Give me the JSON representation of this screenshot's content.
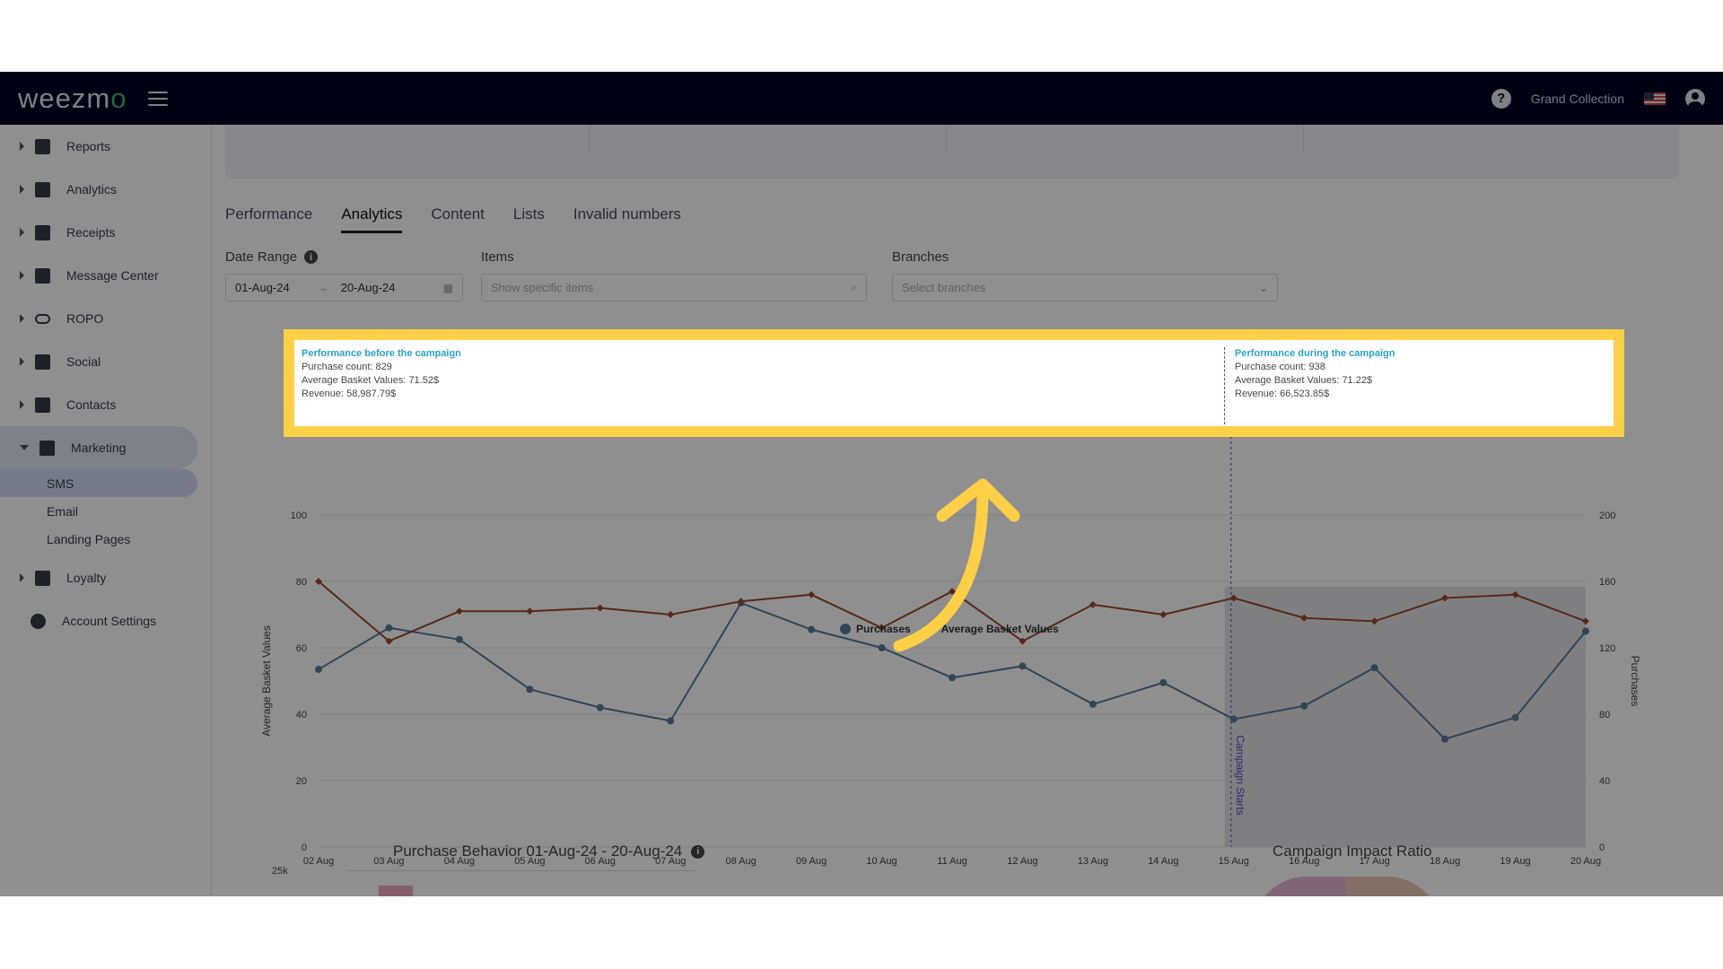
{
  "app": {
    "logo_prefix": "weezm",
    "logo_suffix": "o",
    "org_name": "Grand Collection"
  },
  "sidebar": {
    "items": [
      {
        "label": "Reports"
      },
      {
        "label": "Analytics"
      },
      {
        "label": "Receipts"
      },
      {
        "label": "Message Center"
      },
      {
        "label": "ROPO"
      },
      {
        "label": "Social"
      },
      {
        "label": "Contacts"
      },
      {
        "label": "Marketing"
      }
    ],
    "marketing_sub": [
      {
        "label": "SMS"
      },
      {
        "label": "Email"
      },
      {
        "label": "Landing Pages"
      }
    ],
    "loyalty": "Loyalty",
    "account_settings": "Account Settings"
  },
  "tabs": [
    {
      "label": "Performance"
    },
    {
      "label": "Analytics"
    },
    {
      "label": "Content"
    },
    {
      "label": "Lists"
    },
    {
      "label": "Invalid numbers"
    }
  ],
  "filters": {
    "date_range_label": "Date Range",
    "date_from": "01-Aug-24",
    "date_to": "20-Aug-24",
    "items_label": "Items",
    "items_placeholder": "Show specific items",
    "branches_label": "Branches",
    "branches_placeholder": "Select branches"
  },
  "tooltip": {
    "before_title": "Performance before the campaign",
    "before_count": "Purchase count: 829",
    "before_abv": "Average Basket Values: 71.52$",
    "before_revenue": "Revenue: 58,987.79$",
    "during_title": "Performance during the campaign",
    "during_count": "Purchase count: 938",
    "during_abv": "Average Basket Values: 71.22$",
    "during_revenue": "Revenue: 66,523.85$"
  },
  "bottom": {
    "purchase_behavior_title": "Purchase Behavior 01-Aug-24 - 20-Aug-24",
    "campaign_impact_title": "Campaign Impact Ratio",
    "tick_25k": "25k"
  },
  "chart_data": {
    "type": "line",
    "categories": [
      "02 Aug",
      "03 Aug",
      "04 Aug",
      "05 Aug",
      "06 Aug",
      "07 Aug",
      "08 Aug",
      "09 Aug",
      "10 Aug",
      "11 Aug",
      "12 Aug",
      "13 Aug",
      "14 Aug",
      "15 Aug",
      "16 Aug",
      "17 Aug",
      "18 Aug",
      "19 Aug",
      "20 Aug"
    ],
    "series": [
      {
        "name": "Purchases",
        "axis": "right",
        "color": "#5a7a9a",
        "values": [
          107,
          132,
          125,
          95,
          84,
          76,
          147,
          131,
          120,
          102,
          109,
          86,
          99,
          77,
          85,
          108,
          65,
          78,
          130
        ]
      },
      {
        "name": "Average Basket Values",
        "axis": "left",
        "color": "#9a4a2a",
        "values": [
          80,
          62,
          71,
          71,
          72,
          70,
          74,
          76,
          66,
          77,
          62,
          73,
          70,
          75,
          69,
          68,
          75,
          76,
          68
        ]
      }
    ],
    "ylabel_left": "Average Basket Values",
    "ylabel_right": "Purchases",
    "ylim_left": [
      0,
      100
    ],
    "ylim_right": [
      0,
      200
    ],
    "yticks_left": [
      "0",
      "20",
      "40",
      "60",
      "80",
      "100"
    ],
    "yticks_right": [
      "0",
      "40",
      "80",
      "120",
      "160",
      "200"
    ],
    "annotation": "Campaign Starts",
    "campaign_start_index": 13,
    "grid": true,
    "legend": "bottom-center"
  }
}
